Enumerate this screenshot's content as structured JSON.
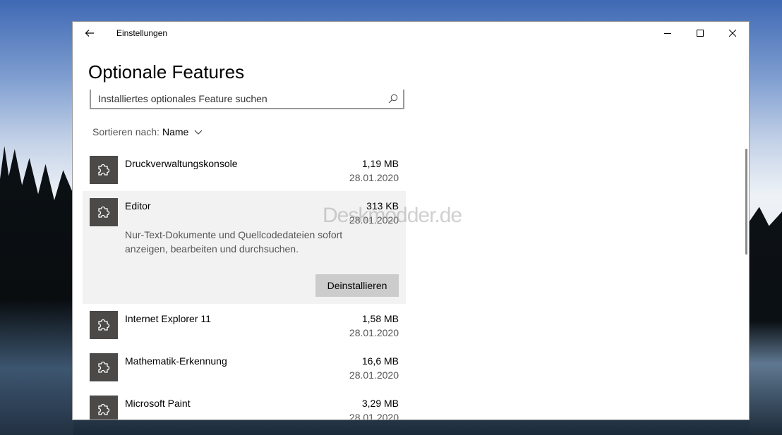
{
  "window": {
    "title": "Einstellungen",
    "page_title": "Optionale Features"
  },
  "search": {
    "placeholder": "Installiertes optionales Feature suchen"
  },
  "sort": {
    "label": "Sortieren nach:",
    "value": "Name"
  },
  "features": [
    {
      "name": "Druckverwaltungskonsole",
      "size": "1,19 MB",
      "date": "28.01.2020"
    },
    {
      "name": "Editor",
      "size": "313 KB",
      "date": "28.01.2020",
      "description": "Nur-Text-Dokumente und Quellcodedateien sofort anzeigen, bearbeiten und durchsuchen.",
      "action_label": "Deinstallieren"
    },
    {
      "name": "Internet Explorer 11",
      "size": "1,58 MB",
      "date": "28.01.2020"
    },
    {
      "name": "Mathematik-Erkennung",
      "size": "16,6 MB",
      "date": "28.01.2020"
    },
    {
      "name": "Microsoft Paint",
      "size": "3,29 MB",
      "date": "28.01.2020"
    }
  ],
  "watermark": "Deskmodder.de",
  "icons": {
    "back": "back-arrow-icon",
    "minimize": "minimize-icon",
    "maximize": "maximize-icon",
    "close": "close-icon",
    "search": "search-icon",
    "sort": "chevron-down-icon",
    "feature": "puzzle-piece-icon"
  },
  "colors": {
    "feature_icon_bg": "#4c4a48",
    "expanded_bg": "#f2f2f2",
    "button_bg": "#cccccc"
  }
}
